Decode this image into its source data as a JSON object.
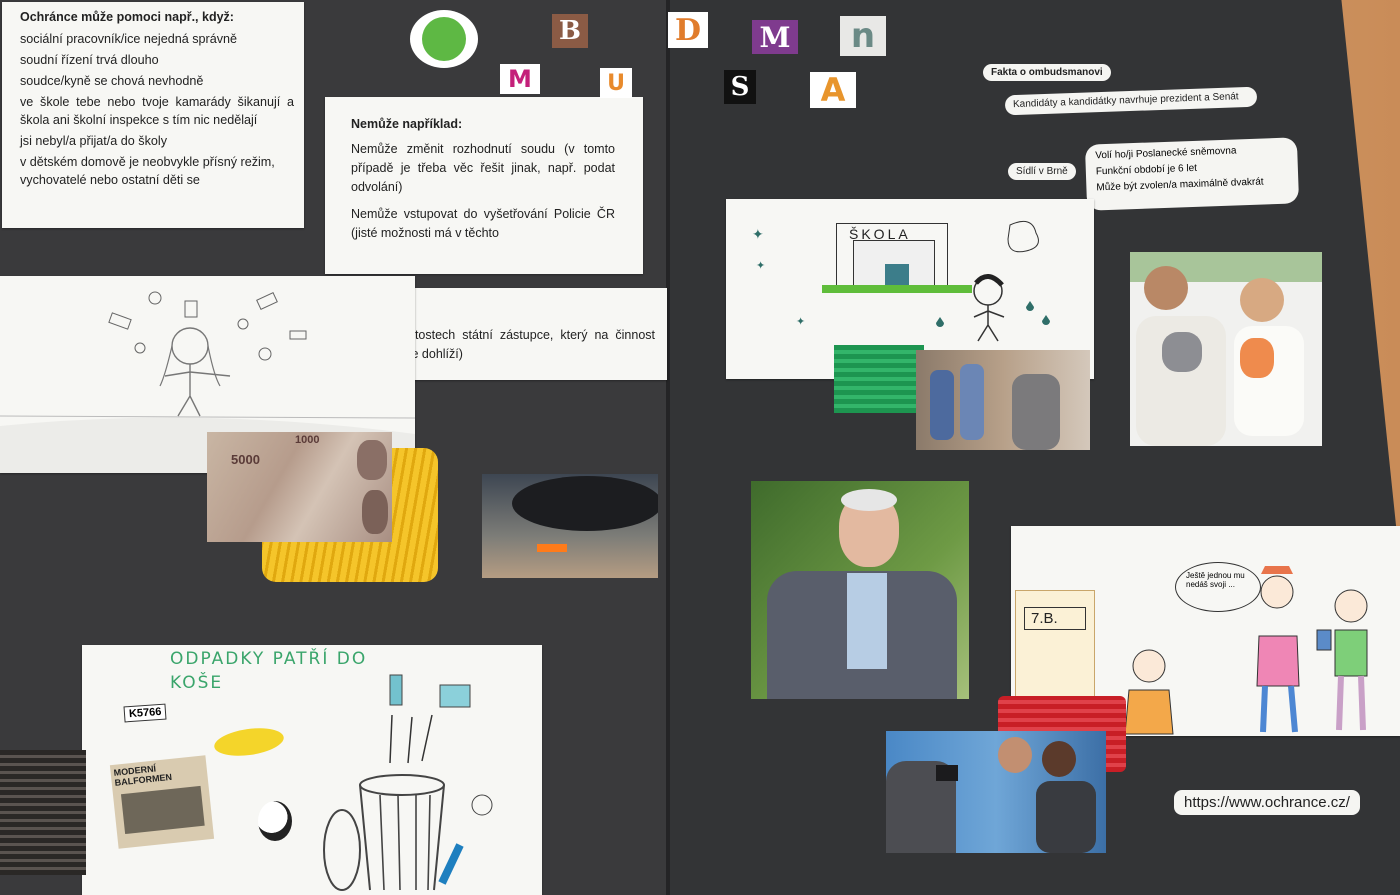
{
  "left_notes": {
    "heading": "Ochránce může pomoci např., když:",
    "items": [
      "sociální pracovník/ice nejedná správně",
      "soudní řízení trvá dlouho",
      "soudce/kyně se chová nevhodně",
      "ve škole tebe nebo tvoje kamarády šikanují a škola ani školní inspekce s tím nic nedělají",
      "jsi nebyl/a přijat/a do školy",
      "v dětském domově je neobvykle přísný režim, vychovatelé nebo ostatní děti se"
    ]
  },
  "cannot_note": {
    "heading": "Nemůže například:",
    "p1": "Nemůže změnit rozhodnutí soudu (v tomto případě je třeba věc řešit jinak, např. podat odvolání)",
    "p2": "Nemůže vstupovat do vyšetřování Policie ČR (jisté možnosti má v těchto",
    "p3": "záležitostech státní zástupce, který na činnost policie dohlíží)"
  },
  "title_letters": {
    "row1": [
      "O",
      "B",
      "D",
      "M",
      "n"
    ],
    "row2": [
      "M",
      "U",
      "S",
      "A"
    ]
  },
  "facts": {
    "heading": "Fakta o ombudsmanovi",
    "f1": "Kandidáty a kandidátky navrhuje prezident a Senát",
    "f2": "Sídlí v Brně",
    "f3": "Volí ho/ji Poslanecké sněmovna",
    "f4": "Funkční období je 6 let",
    "f5": "Může být zvolen/a maximálně dvakrát"
  },
  "drawings": {
    "school_sign": "ŠKOLA",
    "trash_title": "ODPADKY PATŘÍ DO KOŠE",
    "plate": "K5766",
    "magazine": "MODERNÍ BALFORMEN",
    "classroom_sign": "7.B.",
    "speech": "Ještě jednou mu nedáš svoji ..."
  },
  "banknotes": {
    "a": "5000",
    "b": "1000"
  },
  "website": "https://www.ochrance.cz/",
  "colors": {
    "board": "#3a3a3c",
    "table": "#d39b6a",
    "yellow_card": "#f2be1e",
    "green_card": "#1f9a52",
    "red_card": "#d0242a"
  }
}
